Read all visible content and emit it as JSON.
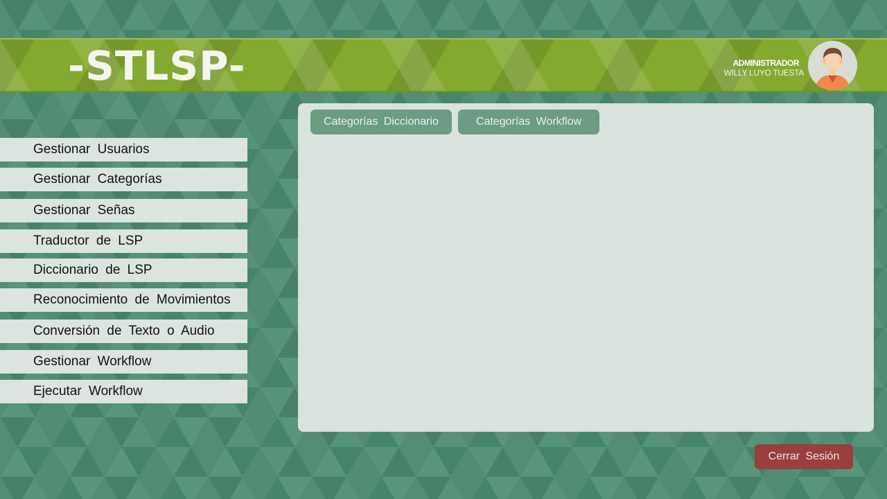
{
  "header": {
    "logo": "-STLSP-",
    "user_role": "ADMINISTRADOR",
    "user_name": "WILLY LUYO TUESTA"
  },
  "sidebar": {
    "items": [
      {
        "label": "Gestionar Usuarios"
      },
      {
        "label": "Gestionar Categorías"
      },
      {
        "label": "Gestionar Señas"
      },
      {
        "label": "Traductor de LSP"
      },
      {
        "label": "Diccionario de LSP"
      },
      {
        "label": "Reconocimiento de Movimientos"
      },
      {
        "label": "Conversión de Texto o Audio"
      },
      {
        "label": "Gestionar Workflow"
      },
      {
        "label": "Ejecutar Workflow"
      }
    ]
  },
  "main": {
    "tabs": [
      {
        "label": "Categorías Diccionario"
      },
      {
        "label": "Categorías Workflow"
      }
    ]
  },
  "footer": {
    "logout_label": "Cerrar Sesión"
  },
  "colors": {
    "background": "#4b8c70",
    "header": "#83a92f",
    "tab": "#6c9c82",
    "logout": "#9a3e3e"
  }
}
